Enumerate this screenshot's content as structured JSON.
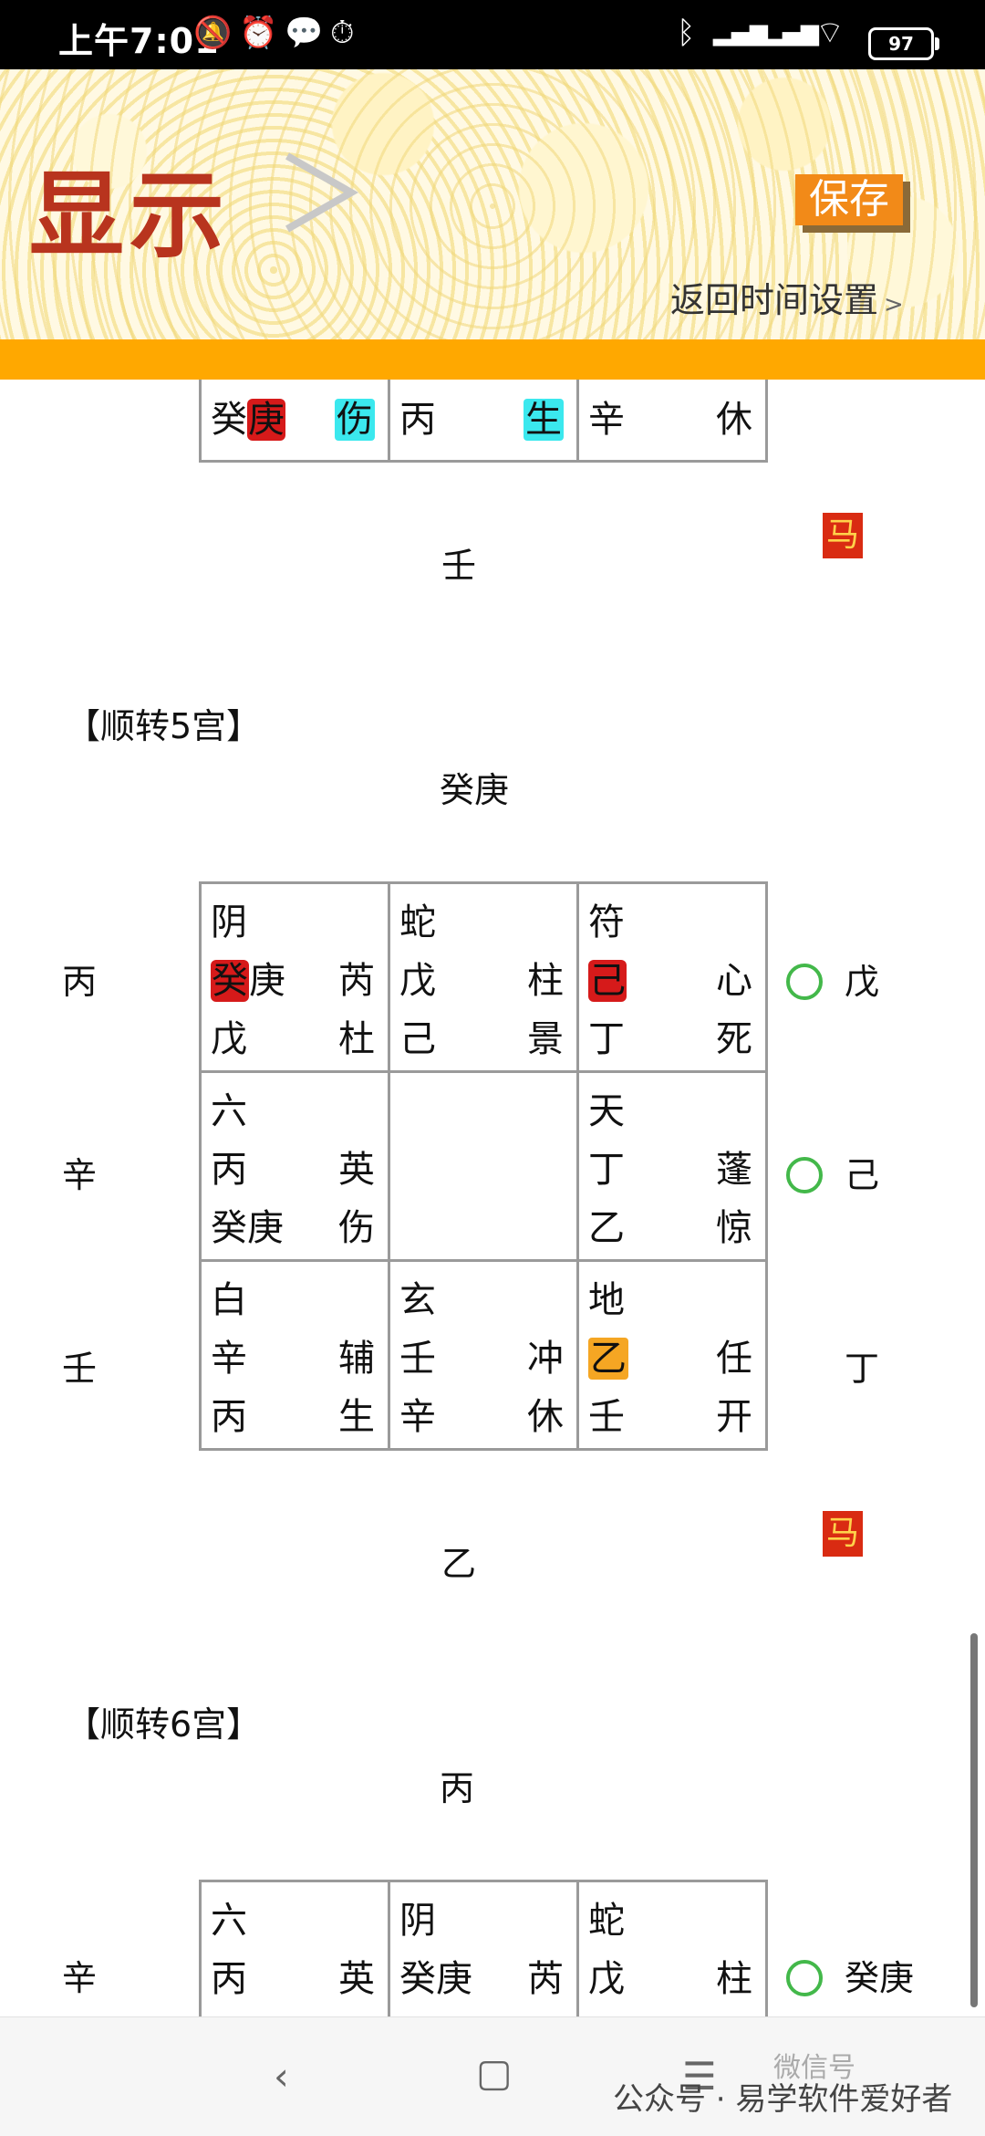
{
  "status_bar": {
    "time": "上午7:01",
    "battery": "97",
    "icons": [
      "mute-bell-icon",
      "alarm-icon",
      "wechat-icon",
      "alarm-icon",
      "bluetooth-icon",
      "signal-hd-icon",
      "signal-icon",
      "wifi-icon",
      "battery-icon"
    ]
  },
  "header": {
    "title": "显示",
    "save_label": "保存",
    "back_label": "返回时间设置",
    "back_chevron": ">"
  },
  "section_top": {
    "row": [
      {
        "a": "癸",
        "b": "庚",
        "c": "伤"
      },
      {
        "a": "丙",
        "c": "生"
      },
      {
        "a": "辛",
        "c": "休"
      }
    ],
    "bottom_char": "壬",
    "horse": "马"
  },
  "section5": {
    "heading": "【顺转5宫】",
    "top_char": "癸庚",
    "left": [
      "丙",
      "辛",
      "壬"
    ],
    "right": [
      "戊",
      "己",
      "丁"
    ],
    "bottom_char": "乙",
    "horse": "马",
    "cells": [
      {
        "god": "阴",
        "l2a": "癸",
        "l2b": "庚",
        "r2": "芮",
        "l3": "戊",
        "r3": "杜"
      },
      {
        "god": "蛇",
        "l2a": "戊",
        "r2": "柱",
        "l3": "己",
        "r3": "景"
      },
      {
        "god": "符",
        "l2a": "己",
        "r2": "心",
        "l3": "丁",
        "r3": "死"
      },
      {
        "god": "六",
        "l2a": "丙",
        "r2": "英",
        "l3": "癸庚",
        "r3": "伤"
      },
      {},
      {
        "god": "天",
        "l2a": "丁",
        "r2": "蓬",
        "l3": "乙",
        "r3": "惊"
      },
      {
        "god": "白",
        "l2a": "辛",
        "r2": "辅",
        "l3": "丙",
        "r3": "生"
      },
      {
        "god": "玄",
        "l2a": "壬",
        "r2": "冲",
        "l3": "辛",
        "r3": "休"
      },
      {
        "god": "地",
        "l2a": "乙",
        "r2": "任",
        "l3": "壬",
        "r3": "开"
      }
    ]
  },
  "section6": {
    "heading": "【顺转6宫】",
    "top_char": "丙",
    "left": [
      "辛"
    ],
    "right": [
      "癸庚"
    ],
    "cells": [
      {
        "god": "六",
        "l2a": "丙",
        "r2": "英"
      },
      {
        "god": "阴",
        "l2a": "癸庚",
        "r2": "芮"
      },
      {
        "god": "蛇",
        "l2a": "戊",
        "r2": "柱"
      }
    ]
  },
  "watermark": {
    "account": "公众号 · 易学软件爱好者",
    "faded": "微信号"
  },
  "colors": {
    "accent_orange": "#ffa800",
    "title_red": "#b8341e",
    "highlight_red": "#d61a1a",
    "highlight_cyan": "#3be8ee",
    "highlight_orange": "#f5a623",
    "circle_green": "#43b84a"
  }
}
